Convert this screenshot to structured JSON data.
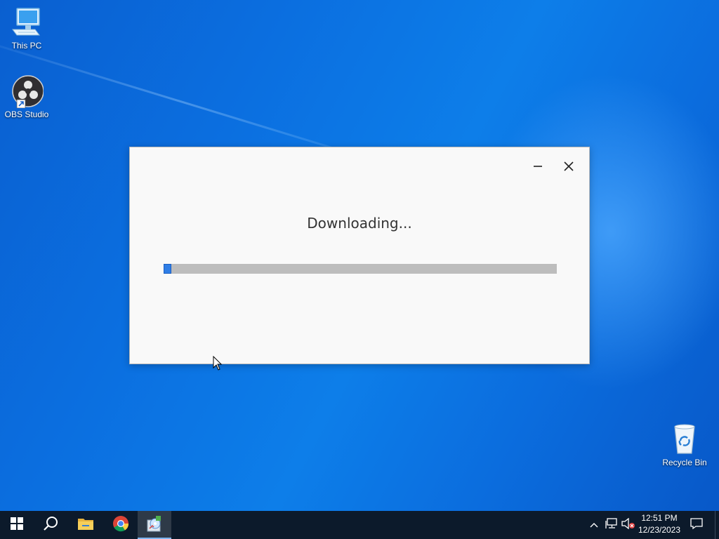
{
  "desktop": {
    "icons": [
      {
        "label": "This PC",
        "icon": "computer-icon"
      },
      {
        "label": "OBS Studio",
        "icon": "obs-icon"
      },
      {
        "label": "Recycle Bin",
        "icon": "recycle-bin-icon"
      }
    ]
  },
  "dialog": {
    "title": "Downloading...",
    "minimize_icon": "minimize-icon",
    "close_icon": "close-icon",
    "progress": 0.02,
    "accent_color": "#2f7ee6",
    "track_color": "#bdbdbd"
  },
  "taskbar": {
    "items": [
      {
        "icon": "windows-start-icon"
      },
      {
        "icon": "search-icon"
      },
      {
        "icon": "file-explorer-icon"
      },
      {
        "icon": "chrome-icon"
      },
      {
        "icon": "installer-app-icon",
        "active": true
      }
    ],
    "tray": {
      "icons": [
        "show-hidden-icons-chevron-icon",
        "network-icon",
        "volume-muted-icon",
        "notification-icon"
      ],
      "time": "12:51 PM",
      "date": "12/23/2023"
    },
    "background_color": "#0c1a2b"
  }
}
